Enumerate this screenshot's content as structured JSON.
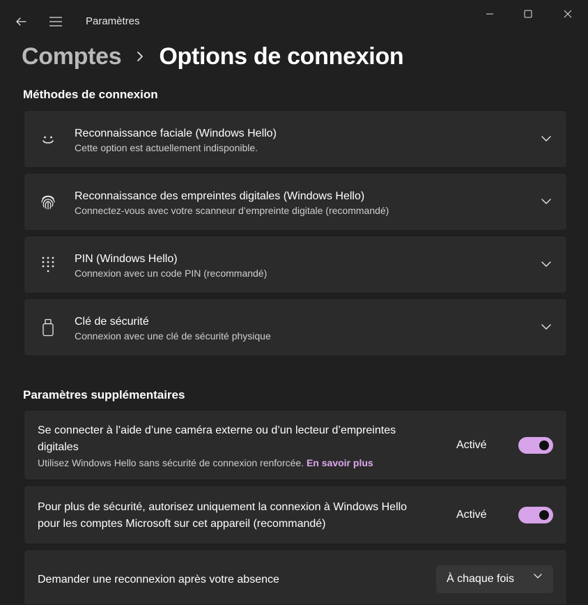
{
  "window": {
    "app_title": "Paramètres"
  },
  "breadcrumb": {
    "parent": "Comptes",
    "current": "Options de connexion"
  },
  "sign_in_methods": {
    "section_title": "Méthodes de connexion",
    "items": [
      {
        "icon": "face-icon",
        "title": "Reconnaissance faciale (Windows Hello)",
        "subtitle": "Cette option est actuellement indisponible."
      },
      {
        "icon": "fingerprint-icon",
        "title": "Reconnaissance des empreintes digitales (Windows Hello)",
        "subtitle": "Connectez-vous avec votre scanneur d’empreinte digitale (recommandé)"
      },
      {
        "icon": "pin-keypad-icon",
        "title": "PIN (Windows Hello)",
        "subtitle": "Connexion avec un code PIN (recommandé)"
      },
      {
        "icon": "usb-key-icon",
        "title": "Clé de sécurité",
        "subtitle": "Connexion avec une clé de sécurité physique"
      }
    ]
  },
  "additional_settings": {
    "section_title": "Paramètres supplémentaires",
    "external_camera": {
      "label_line1": "Se connecter à l’aide d’une caméra externe ou d’un lecteur d’empreintes",
      "label_line2": "digitales",
      "description": "Utilisez Windows Hello sans sécurité de connexion renforcée.",
      "link": "En savoir plus",
      "state": "Activé",
      "toggle_on": true
    },
    "hello_only": {
      "label_line1": "Pour plus de sécurité, autorisez uniquement la connexion à Windows Hello",
      "label_line2": "pour les comptes Microsoft sur cet appareil (recommandé)",
      "state": "Activé",
      "toggle_on": true
    },
    "require_signin": {
      "label": "Demander une reconnexion après votre absence",
      "selected": "À chaque fois"
    }
  },
  "colors": {
    "background": "#202020",
    "card": "#2b2b2b",
    "accent": "#d7a3e8",
    "link": "#e0a7ee"
  }
}
